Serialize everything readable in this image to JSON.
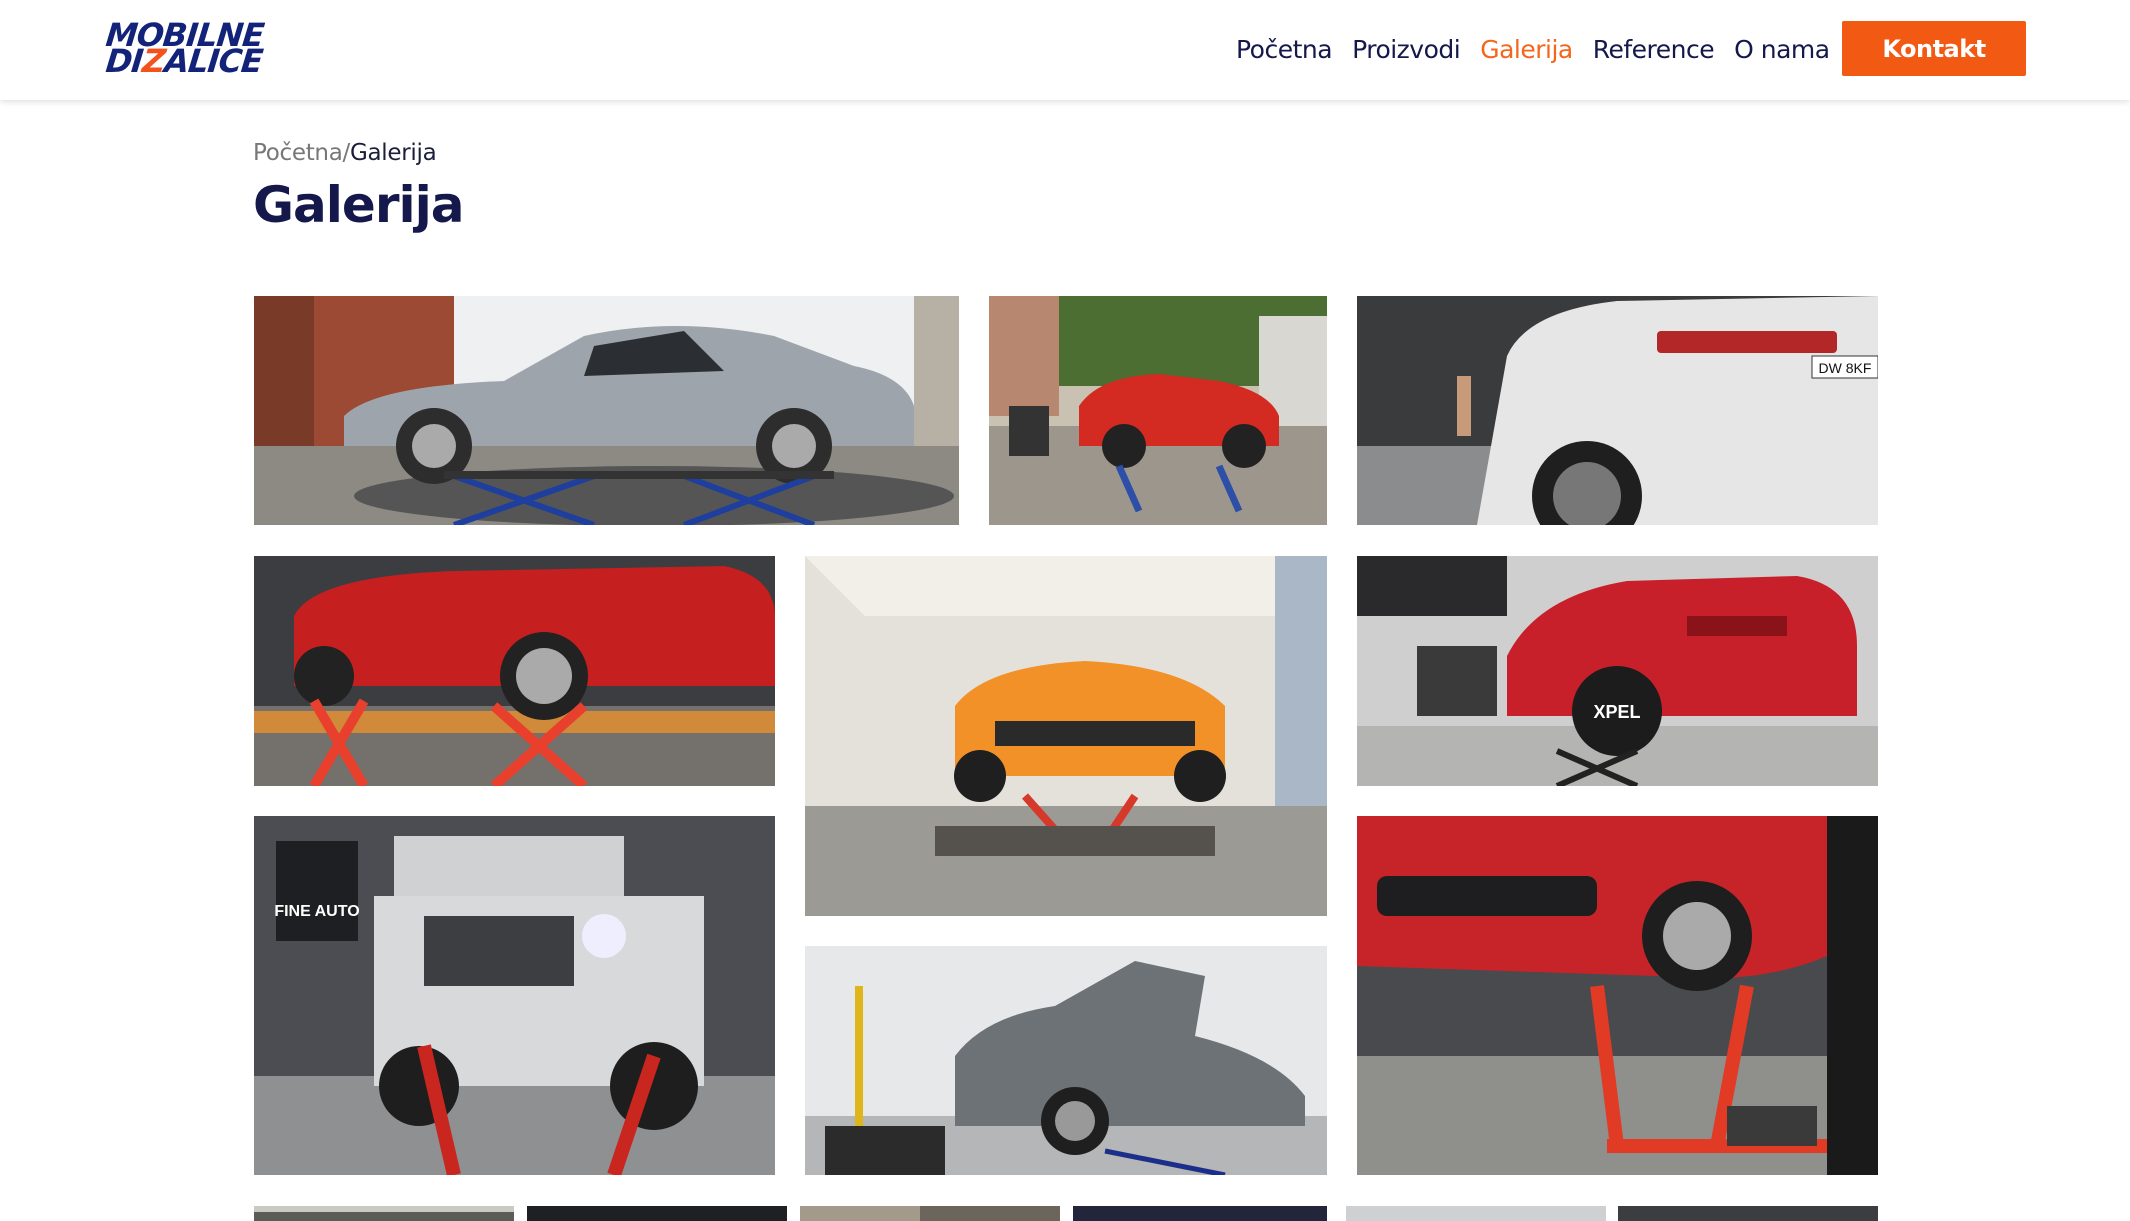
{
  "header": {
    "logo_line1": "MOBILNE",
    "logo_line2_a": "DI",
    "logo_line2_z": "Z",
    "logo_line2_b": "ALICE",
    "nav": [
      {
        "label": "Početna",
        "active": false
      },
      {
        "label": "Proizvodi",
        "active": false
      },
      {
        "label": "Galerija",
        "active": true
      },
      {
        "label": "Reference",
        "active": false
      },
      {
        "label": "O nama",
        "active": false
      }
    ],
    "cta_label": "Kontakt"
  },
  "breadcrumb": {
    "home": "Početna",
    "separator": "/",
    "current": "Galerija"
  },
  "page_title": "Galerija",
  "gallery": {
    "images": [
      {
        "subject": "silver-gullwing-coupe-on-scissor-lift"
      },
      {
        "subject": "red-roadster-on-blue-lift"
      },
      {
        "subject": "white-suv-rear-in-workshop"
      },
      {
        "subject": "red-sports-car-on-red-lift"
      },
      {
        "subject": "orange-supercar-in-tent"
      },
      {
        "subject": "red-suv-on-lift-with-xpel-tire-cover"
      },
      {
        "subject": "silver-off-roader-fine-auto"
      },
      {
        "subject": "grey-supercar-hood-open"
      },
      {
        "subject": "red-sports-car-front-on-lift"
      }
    ],
    "fine_auto_label": "FINE AUTO",
    "xpel_label": "XPEL",
    "plate_label": "DW 8KF"
  },
  "colors": {
    "brand_navy": "#14237a",
    "accent_orange": "#f25a14",
    "nav_active": "#f4661b"
  }
}
